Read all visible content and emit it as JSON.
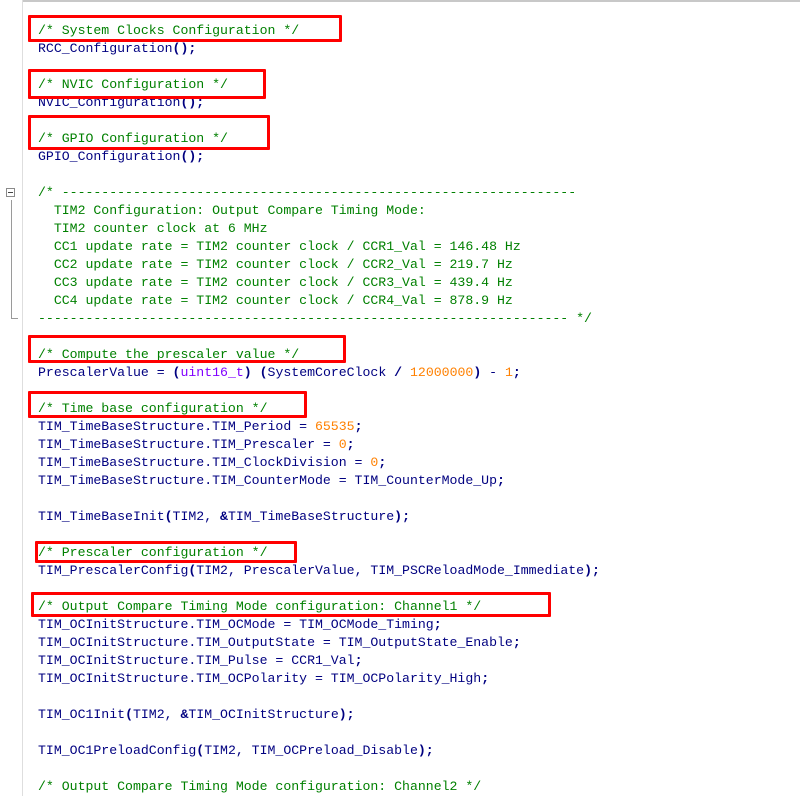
{
  "editor": {
    "lines": {
      "l1": "/* System Clocks Configuration */",
      "l2": "RCC_Configuration",
      "l3": "/* NVIC Configuration */",
      "l4": "NVIC_Configuration",
      "l5": "/* GPIO Configuration */",
      "l6": "GPIO_Configuration",
      "l7": "/* -----------------------------------------------------------------",
      "l8": "  TIM2 Configuration: Output Compare Timing Mode:",
      "l9": "  TIM2 counter clock at 6 MHz",
      "l10": "  CC1 update rate = TIM2 counter clock / CCR1_Val = 146.48 Hz",
      "l11": "  CC2 update rate = TIM2 counter clock / CCR2_Val = 219.7 Hz",
      "l12": "  CC3 update rate = TIM2 counter clock / CCR3_Val = 439.4 Hz",
      "l13": "  CC4 update rate = TIM2 counter clock / CCR4_Val = 878.9 Hz",
      "l14": "------------------------------------------------------------------- */",
      "l15": "/* Compute the prescaler value */",
      "l16a": "PrescalerValue = ",
      "l16b": "uint16_t",
      "l16c": "SystemCoreClock ",
      "l16d": "12000000",
      "l16e": " - ",
      "l16f": "1",
      "l17": "/* Time base configuration */",
      "l18a": "TIM_TimeBaseStructure.TIM_Period = ",
      "l18b": "65535",
      "l19a": "TIM_TimeBaseStructure.TIM_Prescaler = ",
      "l19b": "0",
      "l20a": "TIM_TimeBaseStructure.TIM_ClockDivision = ",
      "l20b": "0",
      "l21": "TIM_TimeBaseStructure.TIM_CounterMode = TIM_CounterMode_Up",
      "l22a": "TIM_TimeBaseInit",
      "l22b": "TIM2, ",
      "l22c": "TIM_TimeBaseStructure",
      "l23": "/* Prescaler configuration */",
      "l24a": "TIM_PrescalerConfig",
      "l24b": "TIM2, PrescalerValue, TIM_PSCReloadMode_Immediate",
      "l25": "/* Output Compare Timing Mode configuration: Channel1 */",
      "l26": "TIM_OCInitStructure.TIM_OCMode = TIM_OCMode_Timing",
      "l27": "TIM_OCInitStructure.TIM_OutputState = TIM_OutputState_Enable",
      "l28": "TIM_OCInitStructure.TIM_Pulse = CCR1_Val",
      "l29": "TIM_OCInitStructure.TIM_OCPolarity = TIM_OCPolarity_High",
      "l30a": "TIM_OC1Init",
      "l30b": "TIM2, ",
      "l30c": "TIM_OCInitStructure",
      "l31a": "TIM_OC1PreloadConfig",
      "l31b": "TIM2, TIM_OCPreload_Disable",
      "l32": "/* Output Compare Timing Mode configuration: Channel2 */"
    },
    "highlight_color": "#ff0000",
    "comment_color": "#008000",
    "number_color": "#ff8000",
    "type_color": "#8000ff",
    "text_color": "#000080"
  }
}
